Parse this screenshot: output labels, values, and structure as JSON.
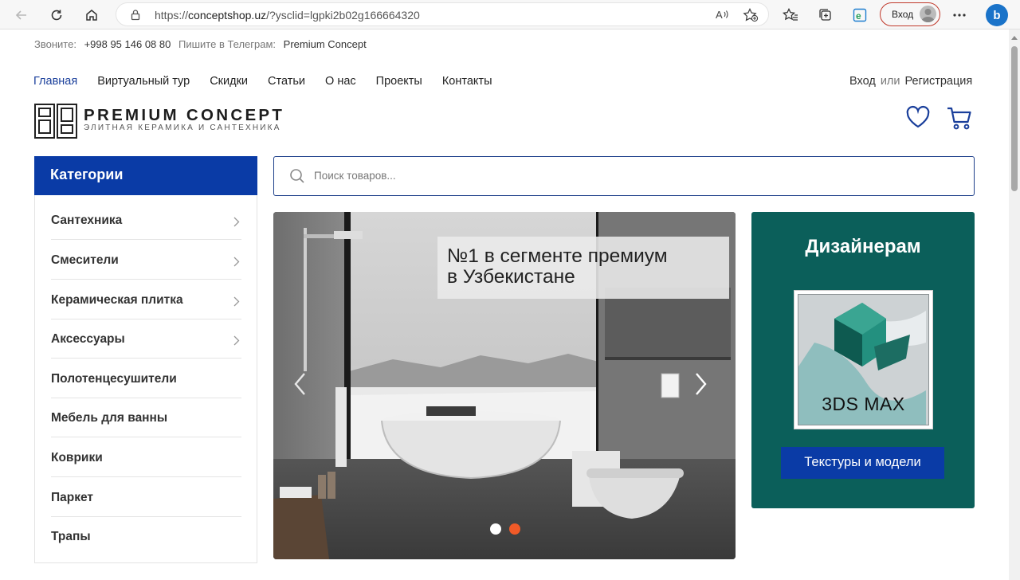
{
  "browser": {
    "url_prefix": "https://",
    "url_host": "conceptshop.uz",
    "url_rest": "/?ysclid=lgpki2b02g166664320",
    "signin_label": "Вход",
    "bing_label": "b"
  },
  "contacts": {
    "call_label": "Звоните:",
    "phone": "+998 95 146 08 80",
    "telegram_label": "Пишите в Телеграм:",
    "telegram_value": "Premium Concept"
  },
  "nav": {
    "items": [
      "Главная",
      "Виртуальный тур",
      "Скидки",
      "Статьи",
      "О нас",
      "Проекты",
      "Контакты"
    ],
    "active_index": 0
  },
  "auth": {
    "login": "Вход",
    "or": "или",
    "register": "Регистрация"
  },
  "logo": {
    "name": "PREMIUM CONCEPT",
    "tagline": "ЭЛИТНАЯ КЕРАМИКА И САНТЕХНИКА"
  },
  "categories": {
    "title": "Категории",
    "items": [
      {
        "label": "Сантехника",
        "has_submenu": true
      },
      {
        "label": "Смесители",
        "has_submenu": true
      },
      {
        "label": "Керамическая плитка",
        "has_submenu": true
      },
      {
        "label": "Аксессуары",
        "has_submenu": true
      },
      {
        "label": "Полотенцесушители",
        "has_submenu": false
      },
      {
        "label": "Мебель для ванны",
        "has_submenu": false
      },
      {
        "label": "Коврики",
        "has_submenu": false
      },
      {
        "label": "Паркет",
        "has_submenu": false
      },
      {
        "label": "Трапы",
        "has_submenu": false
      }
    ]
  },
  "search": {
    "placeholder": "Поиск товаров..."
  },
  "banner": {
    "headline_line1": "№1 в сегменте премиум",
    "headline_line2": "в Узбекистане",
    "slide_count": 2,
    "active_slide": 1,
    "colors": {
      "dot_inactive": "#ffffff",
      "dot_active": "#f05a28"
    }
  },
  "promo": {
    "title": "Дизайнерам",
    "image_label": "3DS MAX",
    "button_label": "Текстуры и модели"
  },
  "colors": {
    "brand_blue": "#0a3ba6",
    "promo_teal": "#0b5f5a",
    "nav_active": "#1a3f9b"
  }
}
